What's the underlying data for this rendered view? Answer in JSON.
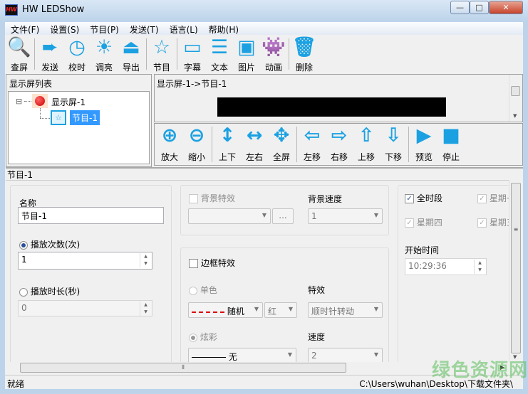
{
  "window": {
    "title": "HW LEDShow",
    "app_icon": "HW",
    "minimize": "—",
    "maximize": "□",
    "close": "✕"
  },
  "menu": [
    "文件(F)",
    "设置(S)",
    "节目(P)",
    "发送(T)",
    "语言(L)",
    "帮助(H)"
  ],
  "toolbar": [
    {
      "label": "查屏",
      "icon": "search-icon",
      "glyph": "🔍"
    },
    {
      "label": "发送",
      "icon": "send-arrow-icon",
      "glyph": "➨"
    },
    {
      "label": "校时",
      "icon": "clock-icon",
      "glyph": "◷"
    },
    {
      "label": "调亮",
      "icon": "brightness-icon",
      "glyph": "☀"
    },
    {
      "label": "导出",
      "icon": "export-icon",
      "glyph": "⏏"
    },
    {
      "label": "节目",
      "icon": "program-icon",
      "glyph": "☆"
    },
    {
      "label": "字幕",
      "icon": "subtitle-icon",
      "glyph": "▭"
    },
    {
      "label": "文本",
      "icon": "text-icon",
      "glyph": "☰"
    },
    {
      "label": "图片",
      "icon": "picture-icon",
      "glyph": "▣"
    },
    {
      "label": "动画",
      "icon": "animation-icon",
      "glyph": "👾"
    },
    {
      "label": "删除",
      "icon": "trash-icon",
      "glyph": "🗑"
    }
  ],
  "tree": {
    "title": "显示屏列表",
    "screen": "显示屏-1",
    "program": "节目-1",
    "expander": "⊟"
  },
  "preview": {
    "path": "显示屏-1->节目-1"
  },
  "toolbar2": [
    {
      "label": "放大",
      "glyph": "⊕"
    },
    {
      "label": "缩小",
      "glyph": "⊖"
    },
    {
      "label": "上下",
      "glyph": "↕"
    },
    {
      "label": "左右",
      "glyph": "↔"
    },
    {
      "label": "全屏",
      "glyph": "✥"
    },
    {
      "label": "左移",
      "glyph": "⇦"
    },
    {
      "label": "右移",
      "glyph": "⇨"
    },
    {
      "label": "上移",
      "glyph": "⇧"
    },
    {
      "label": "下移",
      "glyph": "⇩"
    },
    {
      "label": "预览",
      "glyph": "▶"
    },
    {
      "label": "停止",
      "glyph": "■"
    }
  ],
  "section_title": "节目-1",
  "form": {
    "name_label": "名称",
    "name_value": "节目-1",
    "play_count_label": "播放次数(次)",
    "play_count_value": "1",
    "play_duration_label": "播放时长(秒)",
    "play_duration_value": "0",
    "bg_effect_label": "背景特效",
    "bg_effect_value": "",
    "browse": "...",
    "bg_speed_label": "背景速度",
    "bg_speed_value": "1",
    "border_effect_label": "边框特效",
    "single_color_label": "单色",
    "border_style_value": "随机",
    "color_value": "红",
    "effect_label": "特效",
    "effect_value": "顺时针转动",
    "colorful_label": "炫彩",
    "colorful_style_value": "无",
    "speed_label": "速度",
    "speed_value": "2",
    "all_time_label": "全时段",
    "mon_label": "星期一",
    "thu_label": "星期四",
    "fri_label": "星期五",
    "start_time_label": "开始时间",
    "start_time_value": "10:29:36"
  },
  "status": {
    "left": "就绪",
    "path": "C:\\Users\\wuhan\\Desktop\\下载文件夹\\"
  },
  "watermark": "绿色资源网"
}
